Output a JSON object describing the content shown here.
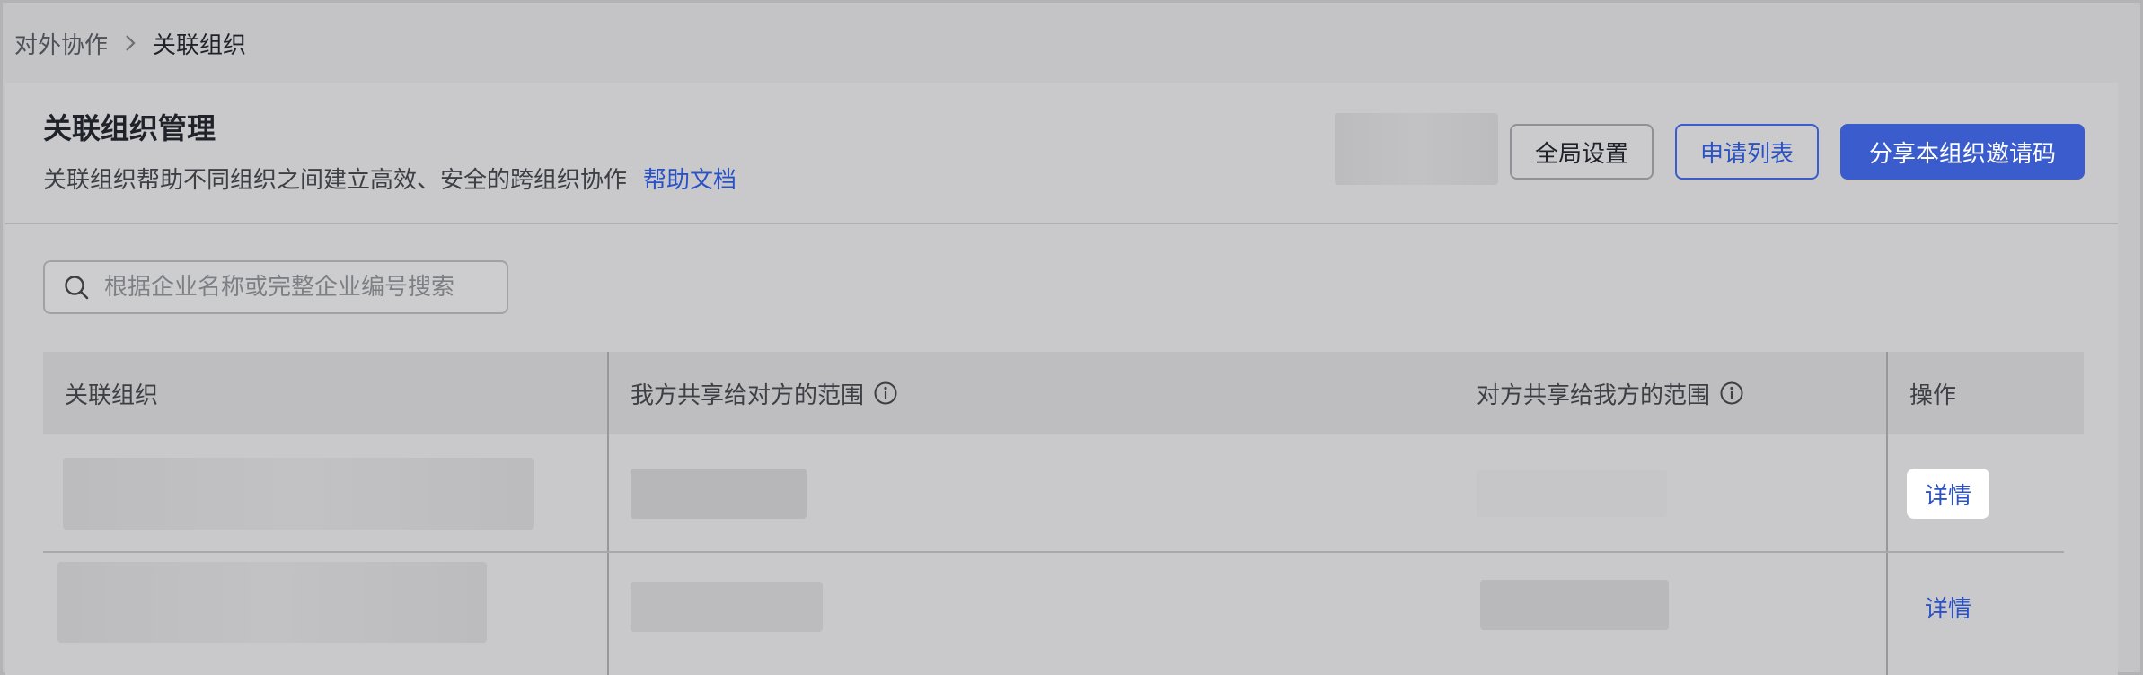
{
  "breadcrumb": {
    "parent": "对外协作",
    "current": "关联组织"
  },
  "header": {
    "title": "关联组织管理",
    "subtitle": "关联组织帮助不同组织之间建立高效、安全的跨组织协作",
    "help_link": "帮助文档",
    "buttons": {
      "global_settings": "全局设置",
      "apply_list": "申请列表",
      "share_invite": "分享本组织邀请码"
    }
  },
  "search": {
    "placeholder": "根据企业名称或完整企业编号搜索",
    "value": ""
  },
  "table": {
    "columns": [
      "关联组织",
      "我方共享给对方的范围",
      "对方共享给我方的范围",
      "操作"
    ],
    "rows": [
      {
        "action": "详情"
      },
      {
        "action": "详情"
      }
    ]
  },
  "colors": {
    "accent": "#3a5ccc",
    "link": "#2b52c4",
    "overlay_bg": "#c4c4c6"
  }
}
